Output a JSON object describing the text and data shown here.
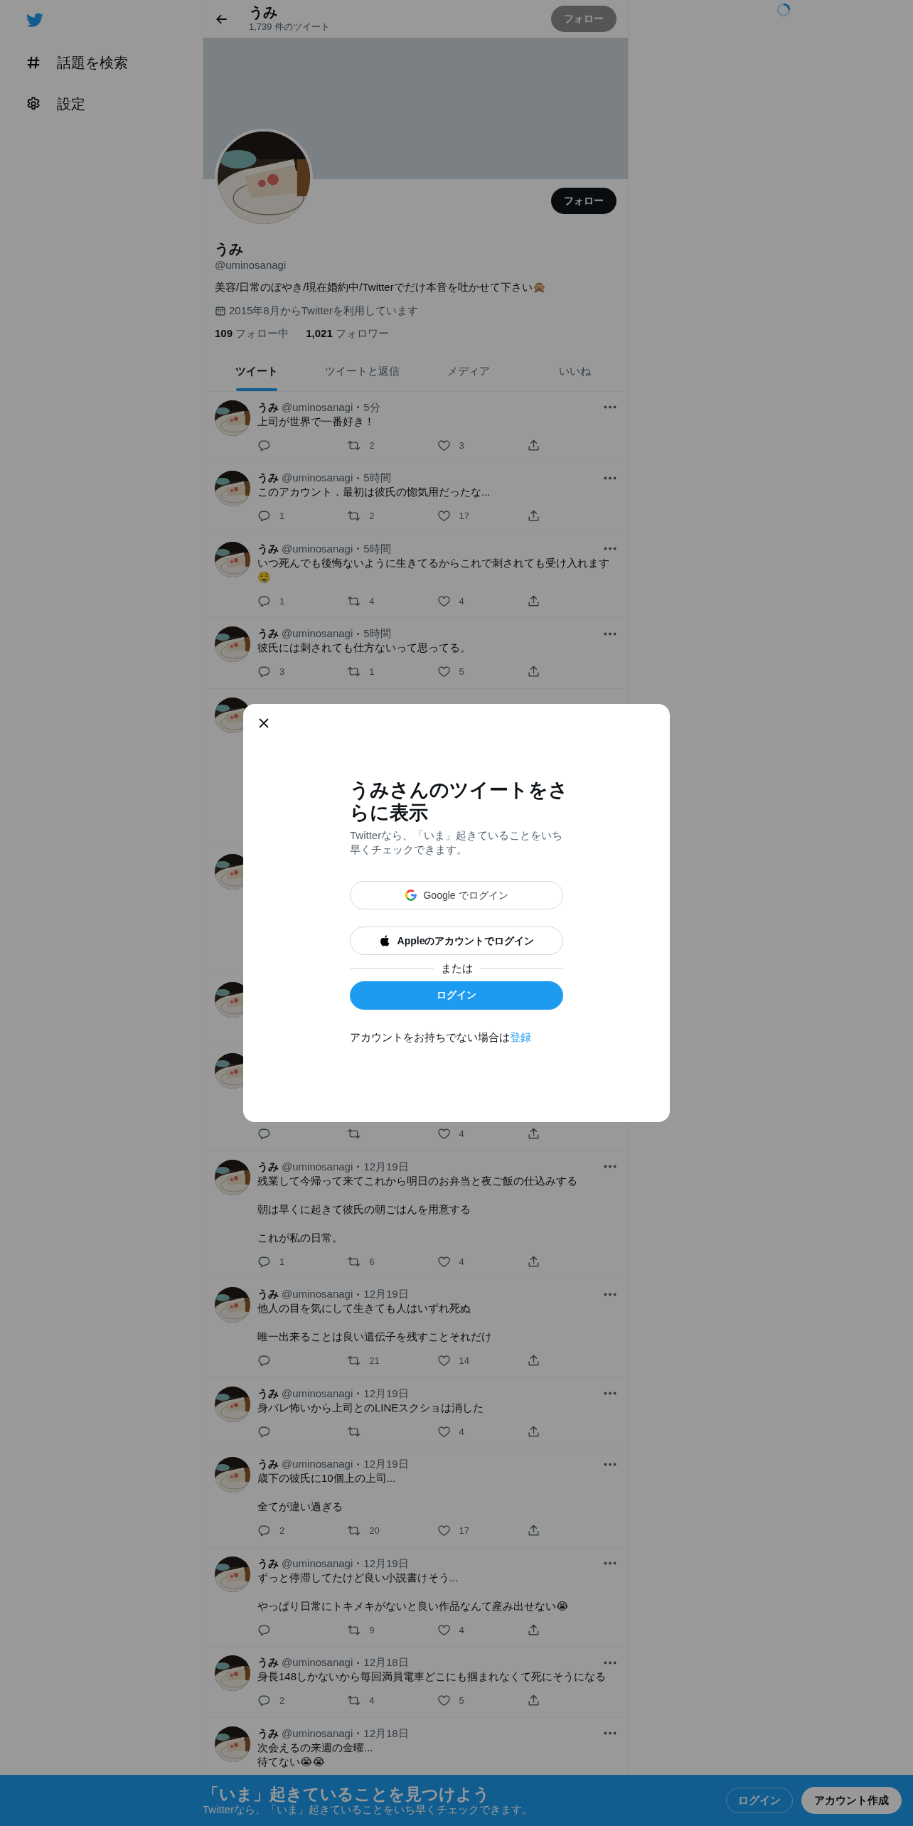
{
  "sidebar": {
    "items": [
      {
        "label": "話題を検索",
        "kind": "hash"
      },
      {
        "label": "設定",
        "kind": "gear"
      }
    ]
  },
  "header": {
    "title": "うみ",
    "tweet_count": "1,739 件のツイート",
    "follow_button": "フォロー"
  },
  "profile": {
    "name": "うみ",
    "handle": "@uminosanagi",
    "bio": "美容/日常のぼやき/現在婚約中/Twitterでだけ本音を吐かせて下さい🙊",
    "joined": "2015年8月からTwitterを利用しています",
    "following_count": "109",
    "following_label": "フォロー中",
    "followers_count": "1,021",
    "followers_label": "フォロワー",
    "follow_button": "フォロー"
  },
  "tabs": [
    {
      "label": "ツイート",
      "selected": true
    },
    {
      "label": "ツイートと返信",
      "selected": false
    },
    {
      "label": "メディア",
      "selected": false
    },
    {
      "label": "いいね",
      "selected": false
    }
  ],
  "tweets": [
    {
      "kind": "full",
      "author": "うみ",
      "handle": "@uminosanagi",
      "time": "5分",
      "paragraphs": [
        [
          "上司が世界で一番好き！"
        ]
      ],
      "retweets": "2",
      "likes": "3"
    },
    {
      "kind": "full",
      "author": "うみ",
      "handle": "@uminosanagi",
      "time": "5時間",
      "paragraphs": [
        [
          "このアカウント．最初は彼氏の惚気用だったな..."
        ]
      ],
      "replies": "1",
      "retweets": "2",
      "likes": "17"
    },
    {
      "kind": "full",
      "author": "うみ",
      "handle": "@uminosanagi",
      "time": "5時間",
      "paragraphs": [
        [
          "いつ死んでも後悔ないように生きてるからこれで刺されても受け入れます🤤"
        ]
      ],
      "replies": "1",
      "retweets": "4",
      "likes": "4"
    },
    {
      "kind": "full",
      "author": "うみ",
      "handle": "@uminosanagi",
      "time": "5時間",
      "paragraphs": [
        [
          "彼氏には刺されても仕方ないって思ってる。"
        ]
      ],
      "replies": "3",
      "retweets": "1",
      "likes": "5"
    },
    {
      "kind": "covered"
    },
    {
      "kind": "covered"
    },
    {
      "kind": "covered"
    },
    {
      "kind": "covered_actions",
      "likes": "4"
    },
    {
      "kind": "full",
      "author": "うみ",
      "handle": "@uminosanagi",
      "time": "12月19日",
      "paragraphs": [
        [
          "残業して今帰って来てこれから明日のお弁当と夜ご飯の仕込みする"
        ],
        [
          "朝は早くに起きて彼氏の朝ごはんを用意する"
        ],
        [
          "これが私の日常。"
        ]
      ],
      "replies": "1",
      "retweets": "6",
      "likes": "4"
    },
    {
      "kind": "full",
      "author": "うみ",
      "handle": "@uminosanagi",
      "time": "12月19日",
      "paragraphs": [
        [
          "他人の目を気にして生きても人はいずれ死ぬ"
        ],
        [
          "唯一出来ることは良い遺伝子を残すことそれだけ"
        ]
      ],
      "retweets": "21",
      "likes": "14"
    },
    {
      "kind": "full",
      "author": "うみ",
      "handle": "@uminosanagi",
      "time": "12月19日",
      "paragraphs": [
        [
          "身バレ怖いから上司とのLINEスクショは消した"
        ]
      ],
      "likes": "4"
    },
    {
      "kind": "full",
      "author": "うみ",
      "handle": "@uminosanagi",
      "time": "12月19日",
      "paragraphs": [
        [
          "歳下の彼氏に10個上の上司..."
        ],
        [
          "全てが違い過ぎる"
        ]
      ],
      "replies": "2",
      "retweets": "20",
      "likes": "17"
    },
    {
      "kind": "full",
      "author": "うみ",
      "handle": "@uminosanagi",
      "time": "12月19日",
      "paragraphs": [
        [
          "ずっと停滞してたけど良い小説書けそう..."
        ],
        [
          "やっぱり日常にトキメキがないと良い作品なんて産み出せない😭"
        ]
      ],
      "retweets": "9",
      "likes": "4"
    },
    {
      "kind": "full",
      "author": "うみ",
      "handle": "@uminosanagi",
      "time": "12月18日",
      "paragraphs": [
        [
          "身長148しかないから毎回満員電車どこにも掴まれなくて死にそうになる"
        ]
      ],
      "replies": "2",
      "retweets": "4",
      "likes": "5"
    },
    {
      "kind": "text_only",
      "author": "うみ",
      "handle": "@uminosanagi",
      "time": "12月18日",
      "paragraphs": [
        [
          "次会えるの来週の金曜...",
          "待てない😭😭"
        ]
      ]
    }
  ],
  "modal": {
    "title": "うみさんのツイートをさらに表示",
    "subtitle": "Twitterなら、「いま」起きていることをいち早くチェックできます。",
    "google_button": "Google でログイン",
    "apple_button": "Appleのアカウントでログイン",
    "divider": "または",
    "login_button": "ログイン",
    "signup_text": "アカウントをお持ちでない場合は",
    "signup_link": "登録"
  },
  "bottom_bar": {
    "title": "「いま」起きていることを見つけよう",
    "subtitle": "Twitterなら、「いま」起きていることをいち早くチェックできます。",
    "login_button": "ログイン",
    "signup_button": "アカウント作成"
  }
}
